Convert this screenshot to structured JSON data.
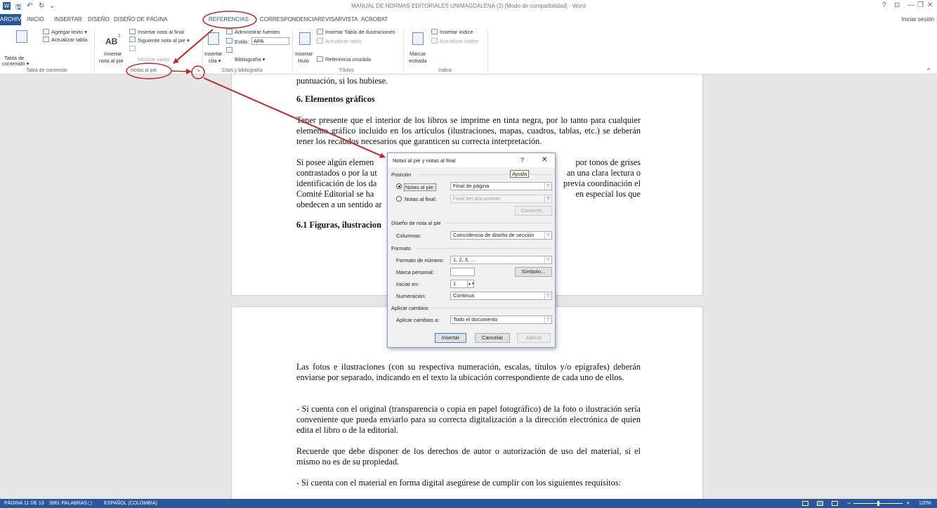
{
  "window": {
    "title": "MANUAL DE NORMAS EDITORIALES UNIMAGDALENA (2) [Modo de compatibilidad] - Word",
    "help": "?",
    "ribbon_display": "⊡",
    "minimize": "—",
    "restore": "❐",
    "close": "✕",
    "sign_in": "Iniciar sesión"
  },
  "qat": {
    "save": "🖫",
    "undo": "↶",
    "redo": "↻",
    "customize": "⌄",
    "app_icon": "W"
  },
  "tabs": [
    "ARCHIVO",
    "INICIO",
    "INSERTAR",
    "DISEÑO",
    "DISEÑO DE PÁGINA",
    "REFERENCIAS",
    "CORRESPONDENCIA",
    "REVISAR",
    "VISTA",
    "ACROBAT"
  ],
  "ribbon": {
    "toc": {
      "agregar_texto": "Agregar texto ▾",
      "actualizar_tabla": "Actualizar tabla",
      "tabla_line1": "Tabla de",
      "tabla_line2": "contenido ▾",
      "group": "Tabla de contenido"
    },
    "footnotes": {
      "ab_icon": "AB",
      "sup": "1",
      "insertar_line1": "Insertar",
      "insertar_line2": "nota al pie",
      "insertar_nota_final": "Insertar nota al final",
      "siguiente_nota": "Siguiente nota al pie ▾",
      "mostrar_notas": "Mostrar notas",
      "group": "Notas al pie",
      "launcher": "↘"
    },
    "citations": {
      "insertar_line1": "Insertar",
      "insertar_line2": "cita ▾",
      "administrar_fuentes": "Administrar fuentes",
      "estilo_label": "Estilo:",
      "estilo_value": "APA",
      "bibliografia": "Bibliografía ▾",
      "group": "Citas y bibliografía"
    },
    "captions": {
      "insertar_line1": "Insertar",
      "insertar_line2": "título",
      "insertar_tabla_ilustraciones": "Insertar Tabla de ilustraciones",
      "actualizar_tabla": "Actualizar tabla",
      "referencia_cruzada": "Referencia cruzada",
      "group": "Títulos"
    },
    "index": {
      "marcar_line1": "Marcar",
      "marcar_line2": "entrada",
      "insertar_indice": "Insertar índice",
      "actualizar_indice": "Actualizar índice",
      "group": "Índice"
    },
    "collapse": "^"
  },
  "document": {
    "page1": [
      {
        "id": "p0",
        "text": "puntuación, si los hubiese.",
        "bold": false
      },
      {
        "id": "p1",
        "text": "6. Elementos gráficos",
        "bold": true
      },
      {
        "id": "p2",
        "text": "Tener presente que el interior de los libros se imprime en tinta negra, por lo tanto para cualquier elemento gráfico incluido en los artículos (ilustraciones, mapas, cuadros, tablas, etc.) se deberán tener los recaudos necesarios que garanticen su correcta interpretación.",
        "bold": false
      },
      {
        "id": "p3a",
        "text": "Si posee algún elemen",
        "bold": false
      },
      {
        "id": "p3b",
        "text": "por tonos de grises",
        "bold": false
      },
      {
        "id": "p4a",
        "text": "contrastados o por la ut",
        "bold": false
      },
      {
        "id": "p4b",
        "text": "an una clara lectura o",
        "bold": false
      },
      {
        "id": "p5a",
        "text": "identificación de los da",
        "bold": false
      },
      {
        "id": "p5b",
        "text": "previa coordinación el",
        "bold": false
      },
      {
        "id": "p6a",
        "text": "Comité Editorial se ha",
        "bold": false
      },
      {
        "id": "p6b",
        "text": "en especial los que",
        "bold": false
      },
      {
        "id": "p7",
        "text": "obedecen a un sentido ar",
        "bold": false
      },
      {
        "id": "p8",
        "text": "6.1 Figuras, ilustracion",
        "bold": true
      }
    ],
    "page2": [
      "Las fotos e ilustraciones (con su respectiva numeración, escalas, títulos y/o epígrafes) deberán enviarse por separado, indicando en el texto la ubicación correspondiente de cada uno de ellos.",
      "- Si cuenta con el original (transparencia o copia en papel fotográfico) de la foto o ilustración sería conveniente que pueda enviarlo para su correcta digitalización a la dirección electrónica de quien edita el libro o de la editorial.",
      "Recuerde que debe disponer de los derechos de autor o autorización de uso del material, si el mismo no es de su propiedad.",
      "- Si cuenta con el material en forma digital asegúrese de cumplir con los siguientes requisitos:"
    ]
  },
  "dialog": {
    "title": "Notas al pie y notas al final",
    "help": "?",
    "close": "✕",
    "tooltip": "Ayuda",
    "posicion": "Posición",
    "notas_pie_label": "Notas al pie:",
    "notas_pie_value": "Final de página",
    "notas_final_label": "Notas al final:",
    "notas_final_value": "Final del documento",
    "convertir": "Convertir...",
    "diseno": "Diseño de nota al pie",
    "columnas_label": "Columnas:",
    "columnas_value": "Coincidencia de diseño de sección",
    "formato": "Formato",
    "formato_numero_label": "Formato de número:",
    "formato_numero_value": "1, 2, 3, ...",
    "marca_personal_label": "Marca personal:",
    "marca_personal_value": "",
    "simbolo": "Símbolo...",
    "iniciar_en_label": "Iniciar en:",
    "iniciar_en_value": "1",
    "numeracion_label": "Numeración:",
    "numeracion_value": "Continua",
    "aplicar_cambios": "Aplicar cambios",
    "aplicar_a_label": "Aplicar cambios a:",
    "aplicar_a_value": "Todo el documento",
    "insertar": "Insertar",
    "cancelar": "Cancelar",
    "aplicar": "Aplicar"
  },
  "status": {
    "page": "PÁGINA 11 DE 13",
    "words": "3961 PALABRAS",
    "proofing_icon": "☐",
    "language": "ESPAÑOL (COLOMBIA)",
    "zoom": "120%",
    "zoom_minus": "−",
    "zoom_plus": "+",
    "zoom_level": 0.5
  },
  "colors": {
    "word_blue": "#2b579a",
    "annotation_red": "#c0282d"
  }
}
